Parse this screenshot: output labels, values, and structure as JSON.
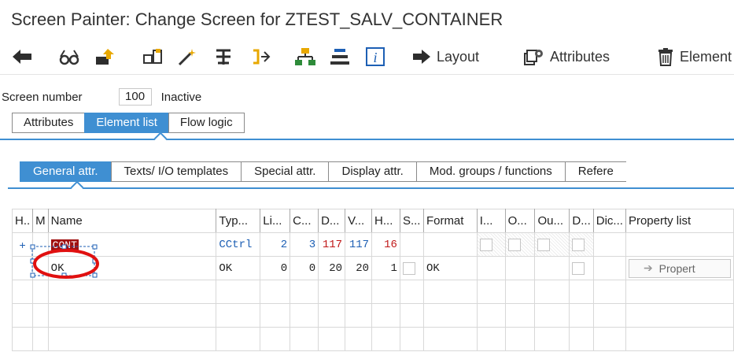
{
  "window": {
    "title": "Screen Painter: Change Screen for ZTEST_SALV_CONTAINER"
  },
  "toolbar": {
    "icons": [
      "back-arrow-icon",
      "glasses-icon",
      "transport-icon",
      "hierarchy-icon",
      "magic-wand-icon",
      "cut-icon",
      "split-icon",
      "tree-icon",
      "align-icon",
      "info-icon",
      "layout-arrow-icon",
      "attributes-icon",
      "trash-icon"
    ],
    "layout_label": "Layout",
    "attributes_label": "Attributes",
    "element_label": "Element"
  },
  "screen": {
    "label": "Screen number",
    "number": "100",
    "status": "Inactive"
  },
  "tabs_main": [
    "Attributes",
    "Element list",
    "Flow logic"
  ],
  "tabs_sub": [
    "General attr.",
    "Texts/ I/O templates",
    "Special attr.",
    "Display attr.",
    "Mod. groups / functions",
    "Refere"
  ],
  "colors": {
    "accent": "#3f8fd2",
    "highlight": "#a01010",
    "annotation": "#e01010"
  },
  "table": {
    "headers": [
      "H..",
      "M",
      "Name",
      "Typ...",
      "Li...",
      "C...",
      "D...",
      "V...",
      "H...",
      "S...",
      "Format",
      "I...",
      "O...",
      "Ou...",
      "D...",
      "Dic...",
      "Property list"
    ],
    "rows": [
      {
        "h": "+",
        "m": "",
        "name": "CONT",
        "type": "CCtrl",
        "li": "2",
        "c": "3",
        "d": "117",
        "v": "117",
        "hh": "16",
        "format": "",
        "prop": ""
      },
      {
        "h": "",
        "m": "",
        "name": "OK",
        "type": "OK",
        "li": "0",
        "c": "0",
        "d": "20",
        "v": "20",
        "hh": "1",
        "format": "OK",
        "prop": "Propert"
      }
    ]
  }
}
